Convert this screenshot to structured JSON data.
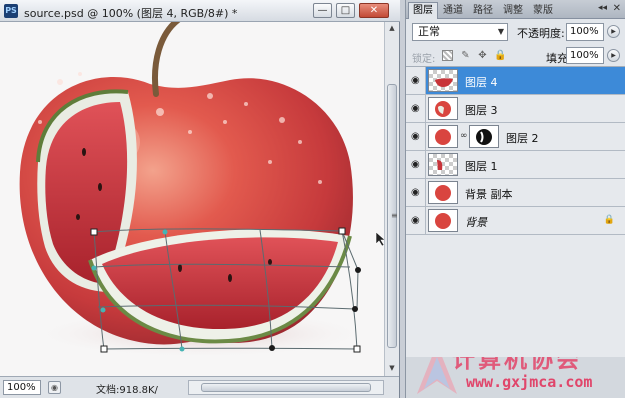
{
  "document": {
    "app_icon": "PS",
    "title": "source.psd @ 100% (图层 4, RGB/8#) *",
    "window_buttons": {
      "minimize": "—",
      "maximize": "□",
      "close": "✕"
    },
    "zoom": "100%",
    "info": "文档:918.8K/",
    "scrollbar_grip": "≡"
  },
  "panel": {
    "tabs": [
      "图层",
      "通道",
      "路径",
      "调整",
      "蒙版"
    ],
    "active_tab": 0,
    "collapse": "◂◂",
    "close": "✕",
    "blend_mode": "正常",
    "opacity_label": "不透明度:",
    "opacity_value": "100%",
    "lock_label": "锁定:",
    "fill_label": "填充:",
    "fill_value": "100%",
    "layers": [
      {
        "name": "图层 4",
        "selected": true,
        "icon": "eye-icon"
      },
      {
        "name": "图层 3",
        "selected": false,
        "icon": "eye-icon"
      },
      {
        "name": "图层 2",
        "selected": false,
        "icon": "eye-icon",
        "has_mask": true
      },
      {
        "name": "图层 1",
        "selected": false,
        "icon": "eye-icon"
      },
      {
        "name": "背景 副本",
        "selected": false,
        "icon": "eye-icon"
      },
      {
        "name": "背景",
        "selected": false,
        "icon": "eye-icon",
        "locked": true
      }
    ]
  },
  "watermark": {
    "text": "计算机协会",
    "url": "www.gxjmca.com"
  },
  "colors": {
    "selection": "#3d8ad8",
    "apple_red": "#d9453f",
    "melon_flesh": "#c8343a",
    "rind_green": "#6b7b45"
  }
}
